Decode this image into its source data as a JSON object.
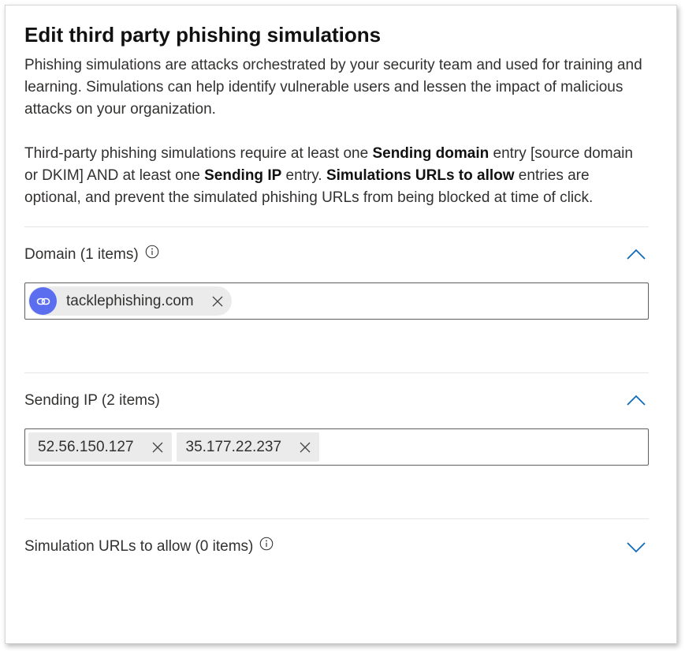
{
  "panel": {
    "title": "Edit third party phishing simulations",
    "intro": "Phishing simulations are attacks orchestrated by your security team and used for training and learning. Simulations can help identify vulnerable users and lessen the impact of malicious attacks on your organization.",
    "req": {
      "p1": "Third-party phishing simulations require at least one ",
      "b1": "Sending domain",
      "p2": " entry [source domain or DKIM] AND at least one ",
      "b2": "Sending IP",
      "p3": " entry. ",
      "b3": "Simulations URLs to allow",
      "p4": " entries are optional, and prevent the simulated phishing URLs from being blocked at time of click."
    }
  },
  "sections": {
    "domain": {
      "title": "Domain (1 items)",
      "info_icon": "info-icon",
      "chevron": "chevron-up-icon",
      "tags": [
        "tacklephishing.com"
      ],
      "tag_icon": "link-icon"
    },
    "sending_ip": {
      "title": "Sending IP (2 items)",
      "chevron": "chevron-up-icon",
      "tags": [
        "52.56.150.127",
        "35.177.22.237"
      ]
    },
    "urls": {
      "title": "Simulation URLs to allow (0 items)",
      "info_icon": "info-icon",
      "chevron": "chevron-down-icon"
    }
  },
  "colors": {
    "accent": "#0f6cbd",
    "avatar": "#5b6ef0",
    "chip_bg": "#ebebeb"
  }
}
